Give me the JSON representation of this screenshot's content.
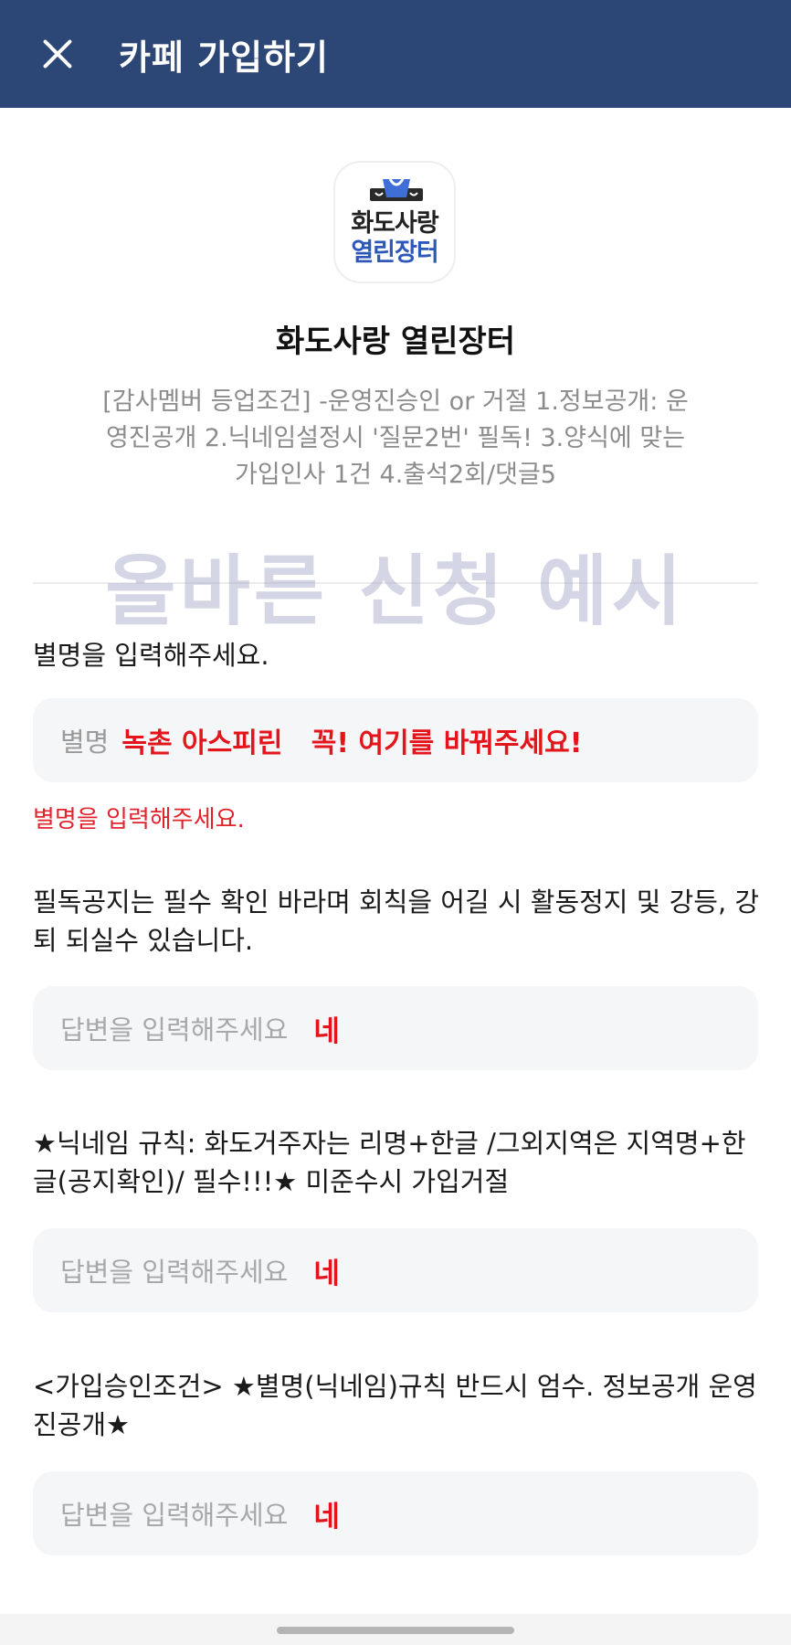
{
  "header": {
    "title": "카페 가입하기",
    "close_icon": "close-icon"
  },
  "logo": {
    "line1": "화도사랑",
    "line2": "열린장터",
    "accent_color": "#2d57b8"
  },
  "cafe": {
    "name": "화도사랑 열린장터",
    "description": "[감사멤버 등업조건] -운영진승인 or 거절 1.정보공개: 운영진공개 2.닉네임설정시 '질문2번' 필독! 3.양식에 맞는 가입인사 1건 4.출석2회/댓글5"
  },
  "watermark": "올바른 신청 예시",
  "form": {
    "nickname": {
      "label": "별명을 입력해주세요.",
      "prefix": "별명",
      "value": "녹촌 아스피린   꼭! 여기를 바꿔주세요!",
      "error": "별명을 입력해주세요."
    },
    "questions": [
      {
        "label": "필독공지는 필수 확인 바라며 회칙을 어길 시 활동정지 및 강등, 강퇴 되실수 있습니다.",
        "placeholder": "답변을 입력해주세요",
        "answer": "네"
      },
      {
        "label": "★닉네임 규칙: 화도거주자는 리명+한글 /그외지역은 지역명+한글(공지확인)/ 필수!!!★ 미준수시 가입거절",
        "placeholder": "답변을 입력해주세요",
        "answer": "네"
      },
      {
        "label": "<가입승인조건> ★별명(닉네임)규칙 반드시 엄수. 정보공개 운영진공개★",
        "placeholder": "답변을 입력해주세요",
        "answer": "네"
      }
    ]
  },
  "colors": {
    "header_bg": "#2c4675",
    "error": "#e0242c",
    "answer": "#e4151a"
  }
}
